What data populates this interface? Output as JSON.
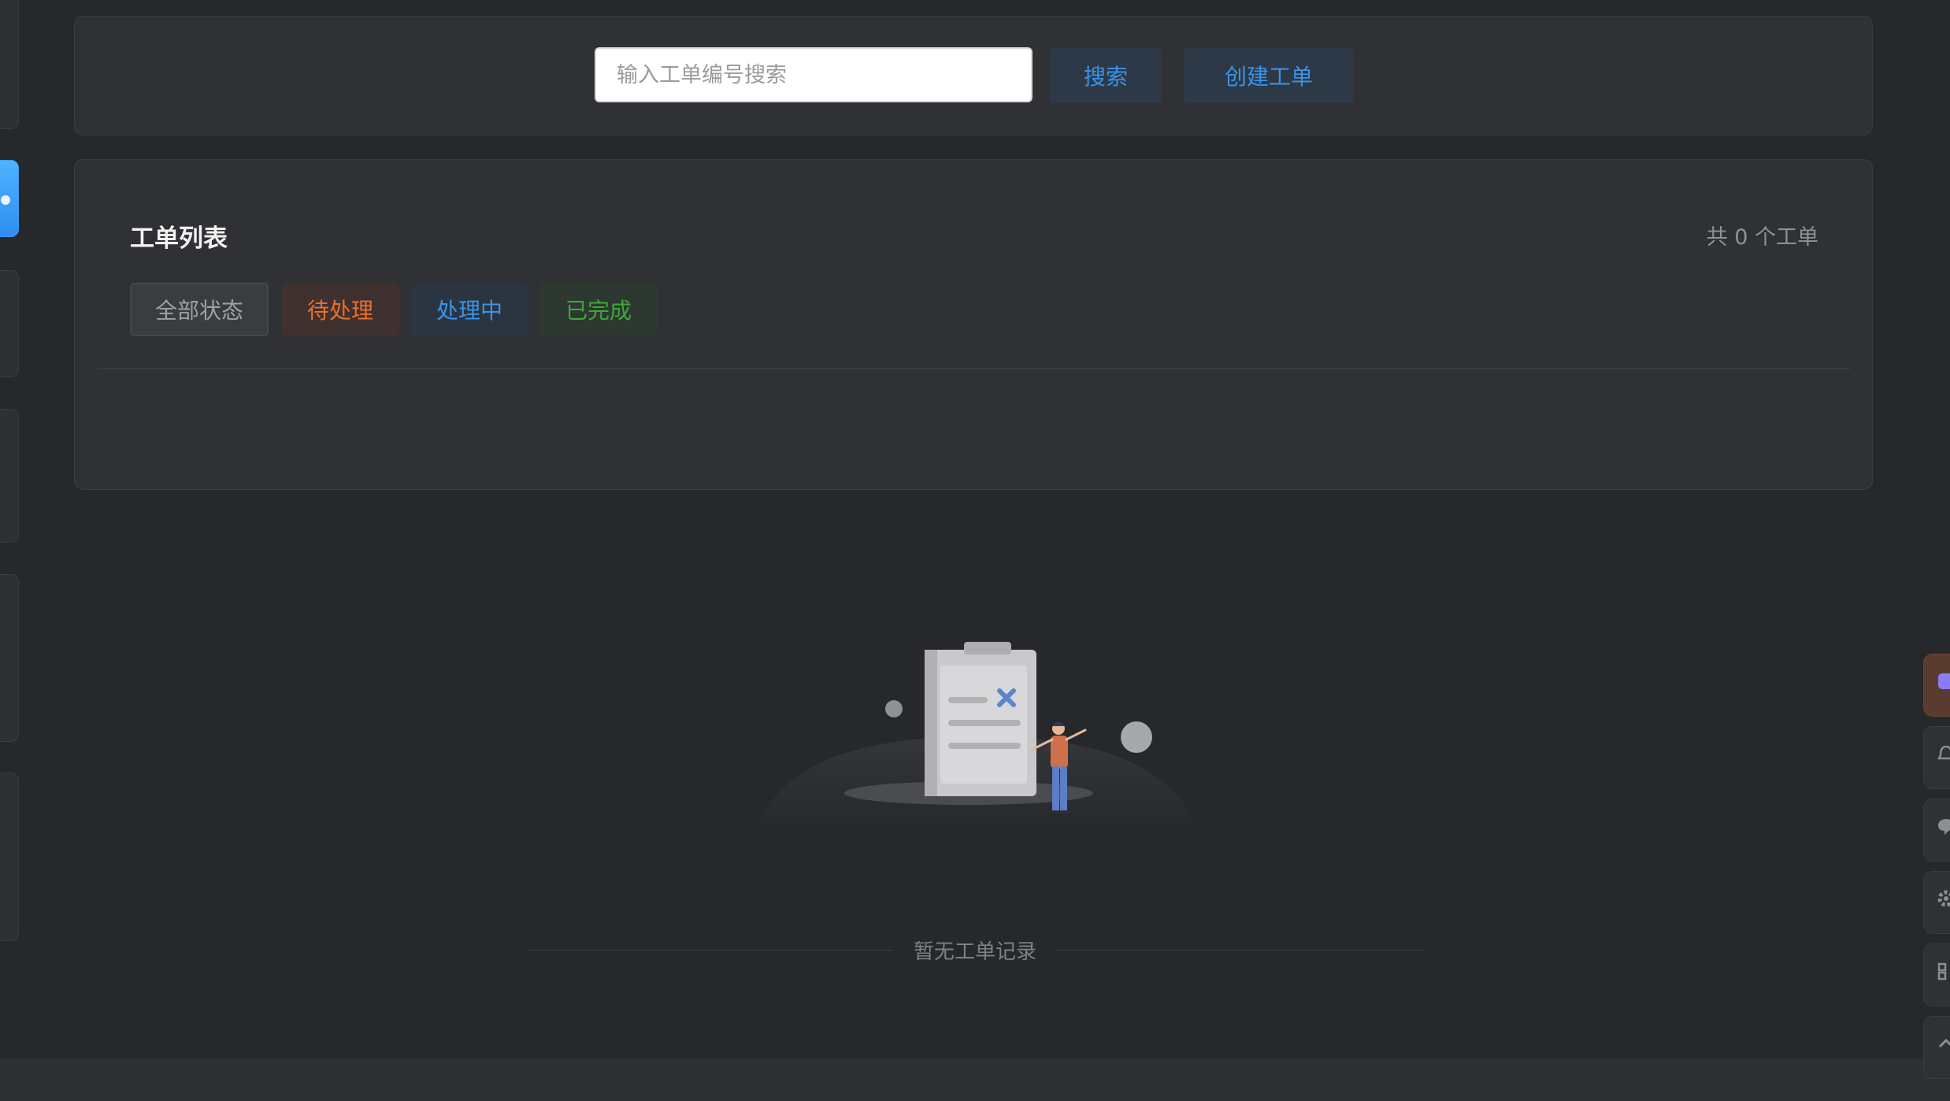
{
  "search": {
    "placeholder": "输入工单编号搜索",
    "search_button": "搜索",
    "create_button": "创建工单"
  },
  "ticket_list": {
    "title": "工单列表",
    "count_text": "共 0 个工单",
    "filters": [
      {
        "label": "全部状态",
        "color": "#9da1a6"
      },
      {
        "label": "待处理",
        "color": "#e8702b"
      },
      {
        "label": "处理中",
        "color": "#3a93e8"
      },
      {
        "label": "已完成",
        "color": "#3ca83a"
      }
    ]
  },
  "empty_state": {
    "message": "暂无工单记录",
    "illustration_icon": "clipboard-person-illustration"
  },
  "right_rail": {
    "icons": [
      "brand-icon",
      "bell-icon",
      "chat-icon",
      "settings-icon",
      "grid-icon",
      "chevron-up-icon"
    ]
  },
  "colors": {
    "accent": "#3a93e8",
    "background": "#26282b",
    "card": "#2f3134"
  }
}
